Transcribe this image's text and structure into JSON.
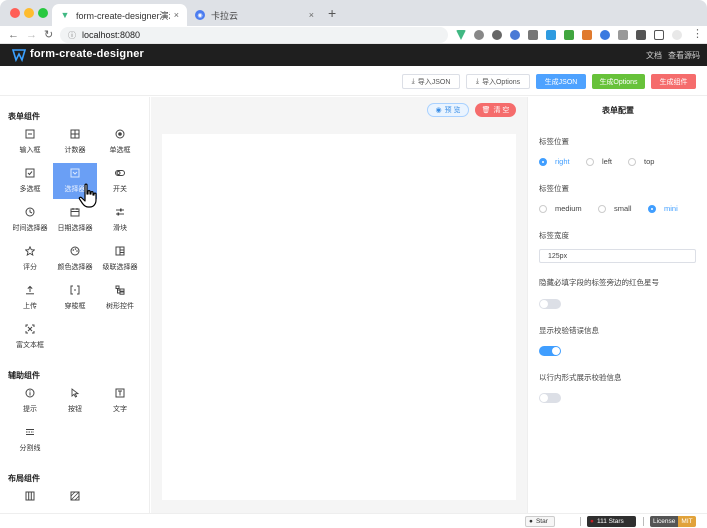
{
  "browser": {
    "tabs": [
      {
        "title": "form-create-designer演示",
        "icon": "vue-icon",
        "active": true
      },
      {
        "title": "卡拉云",
        "icon": "kalayun-icon",
        "active": false
      }
    ],
    "close_glyph": "×",
    "new_tab_glyph": "+",
    "url": "localhost:8080",
    "nav": {
      "back": "←",
      "forward": "→",
      "reload": "↻"
    }
  },
  "app": {
    "title": "form-create-designer",
    "links": [
      "文档",
      "查看源码"
    ]
  },
  "actions": {
    "import_json": "导入JSON",
    "import_options": "导入Options",
    "gen_json": "生成JSON",
    "gen_options": "生成Options",
    "gen_component": "生成组件"
  },
  "left": {
    "groups": [
      {
        "title": "表单组件",
        "items": [
          "输入框",
          "计数器",
          "单选框",
          "多选框",
          "选择器",
          "开关",
          "时间选择器",
          "日期选择器",
          "滑块",
          "评分",
          "颜色选择器",
          "级联选择器",
          "上传",
          "穿梭框",
          "树形控件",
          "富文本框"
        ]
      },
      {
        "title": "辅助组件",
        "items": [
          "提示",
          "按钮",
          "文字",
          "分割线"
        ]
      },
      {
        "title": "布局组件",
        "items": []
      }
    ],
    "selected": "选择器"
  },
  "center": {
    "preview": "预 览",
    "clear": "清 空"
  },
  "right": {
    "title": "表单配置",
    "label_position": {
      "label": "标签位置",
      "options": [
        "right",
        "left",
        "top"
      ],
      "selected": "right"
    },
    "size": {
      "label": "标签位置",
      "options": [
        "medium",
        "small",
        "mini"
      ],
      "selected": "mini"
    },
    "label_width": {
      "label": "标签宽度",
      "value": "125px"
    },
    "hide_required": {
      "label": "隐藏必填字段的标签旁边的红色星号",
      "on": false
    },
    "show_message": {
      "label": "显示校验错误信息",
      "on": true
    },
    "inline_message": {
      "label": "以行内形式展示校验信息",
      "on": false
    }
  },
  "footer": {
    "star": "Star",
    "stars_count": "111 Stars",
    "license": "License",
    "license_value": "MIT"
  },
  "colors": {
    "primary": "#409eff",
    "green": "#67c23a",
    "red": "#f56c6c",
    "header": "#1f1f1f"
  }
}
